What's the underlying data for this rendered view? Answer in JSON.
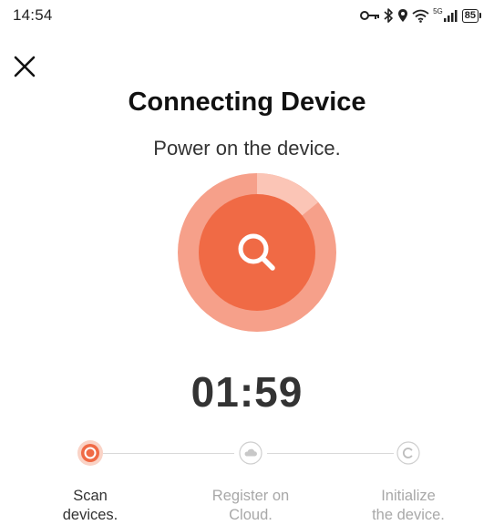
{
  "status_bar": {
    "time": "14:54",
    "network_type": "5G",
    "battery": "85",
    "icons": [
      "key-icon",
      "bluetooth-icon",
      "location-icon",
      "wifi-icon",
      "signal-icon",
      "battery-icon"
    ]
  },
  "header": {
    "close_icon": "close-icon",
    "title": "Connecting Device",
    "subtitle": "Power on the device."
  },
  "scanner": {
    "icon": "search-icon",
    "timer": "01:59"
  },
  "steps": [
    {
      "line1": "Scan",
      "line2": "devices.",
      "icon": "scan-icon",
      "state": "active"
    },
    {
      "line1": "Register on",
      "line2": "Cloud.",
      "icon": "cloud-icon",
      "state": "pending"
    },
    {
      "line1": "Initialize",
      "line2": "the device.",
      "icon": "copyright-icon",
      "state": "pending"
    }
  ],
  "colors": {
    "accent": "#F06A45",
    "accent_light": "#F6A08A",
    "inactive": "#A8A8A8",
    "text_dark": "#111111"
  }
}
